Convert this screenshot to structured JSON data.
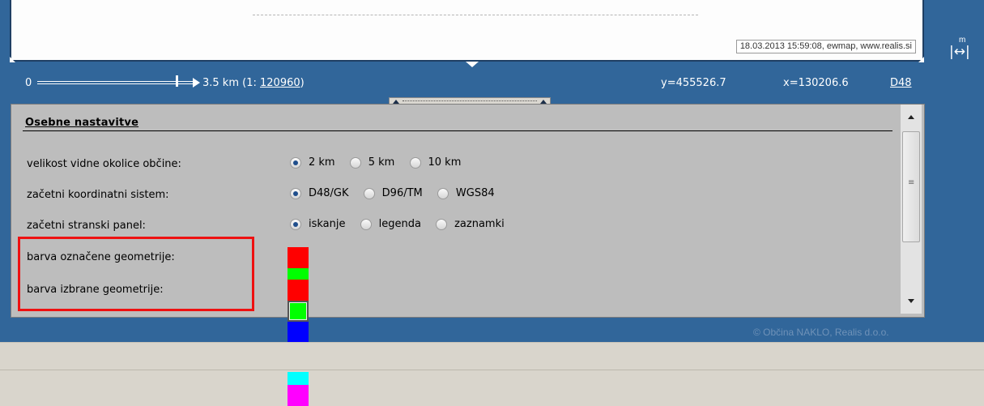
{
  "map": {
    "stamp": "18.03.2013 15:59:08, ewmap, www.realis.si"
  },
  "measure_tool": {
    "unit": "m",
    "icon": "measure-distance-icon"
  },
  "scalebar": {
    "zero": "0",
    "distance": "3.5 km (1: ",
    "scale_value": "120960",
    "closing": ")",
    "y": "y=455526.7",
    "x": "x=130206.6",
    "crs": "D48"
  },
  "panel": {
    "title": "Osebne nastavitve",
    "rows": [
      {
        "label": "velikost vidne okolice občine:",
        "options": [
          "2 km",
          "5 km",
          "10 km"
        ],
        "selected": 0
      },
      {
        "label": "začetni koordinatni sistem:",
        "options": [
          "D48/GK",
          "D96/TM",
          "WGS84"
        ],
        "selected": 0
      },
      {
        "label": "začetni stranski panel:",
        "options": [
          "iskanje",
          "legenda",
          "zaznamki"
        ],
        "selected": 0
      }
    ],
    "color_rows": [
      {
        "label": "barva označene geometrije:",
        "selected": 3
      },
      {
        "label": "barva izbrane geometrije:",
        "selected": 1
      }
    ],
    "swatch_colors": [
      "#ff0000",
      "#00ff00",
      "#0000ff",
      "#ffff00",
      "#00ffff",
      "#ff00ff"
    ]
  },
  "footer": {
    "copyright": "© Občina NAKLO, Realis d.o.o."
  }
}
